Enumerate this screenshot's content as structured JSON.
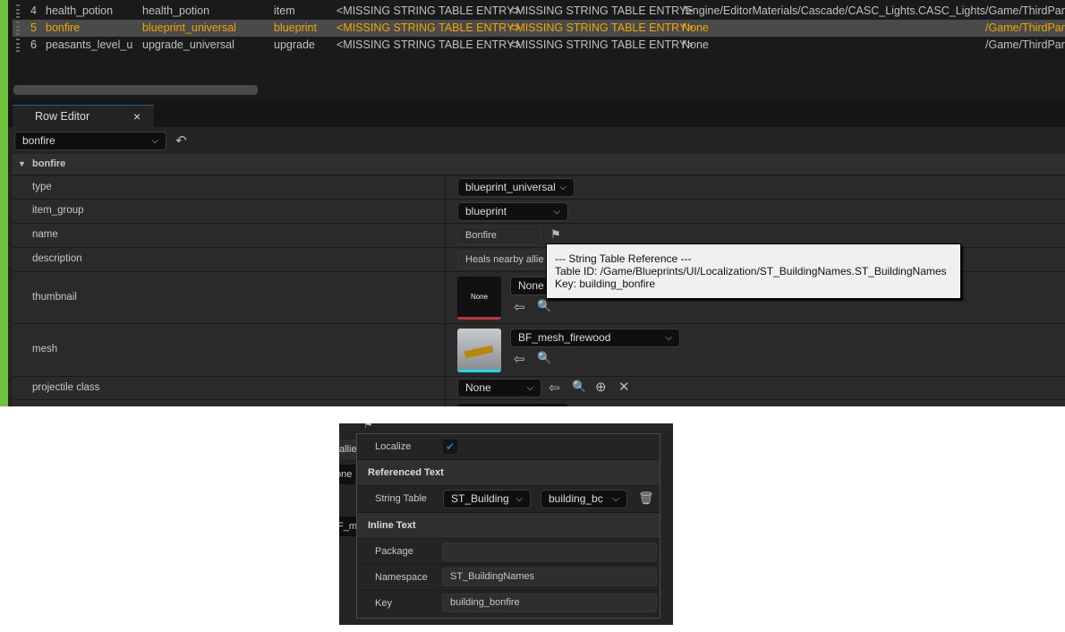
{
  "table": {
    "rows": [
      {
        "num": "4",
        "name": "health_potion",
        "c2": "health_potion",
        "c3": "item",
        "c4": "<MISSING STRING TABLE ENTRY>",
        "c5": "<MISSING STRING TABLE ENTRY>",
        "c6": "/Engine/EditorMaterials/Cascade/CASC_Lights.CASC_Lights",
        "c7": "/Game/ThirdPar"
      },
      {
        "num": "5",
        "name": "bonfire",
        "c2": "blueprint_universal",
        "c3": "blueprint",
        "c4": "<MISSING STRING TABLE ENTRY>",
        "c5": "<MISSING STRING TABLE ENTRY>",
        "c6": "None",
        "c7": "/Game/ThirdPar"
      },
      {
        "num": "6",
        "name": "peasants_level_u",
        "c2": "upgrade_universal",
        "c3": "upgrade",
        "c4": "<MISSING STRING TABLE ENTRY>",
        "c5": "<MISSING STRING TABLE ENTRY>",
        "c6": "None",
        "c7": "/Game/ThirdPar"
      }
    ]
  },
  "row_editor": {
    "tab_label": "Row Editor",
    "close": "×",
    "row_select": "bonfire",
    "section": "bonfire",
    "props": {
      "type": {
        "label": "type",
        "value": "blueprint_universal"
      },
      "item_group": {
        "label": "item_group",
        "value": "blueprint"
      },
      "name": {
        "label": "name",
        "value": "Bonfire"
      },
      "description": {
        "label": "description",
        "value": "Heals nearby allie"
      },
      "thumbnail": {
        "label": "thumbnail",
        "thumb": "None",
        "value": "None"
      },
      "mesh": {
        "label": "mesh",
        "value": "BF_mesh_firewood"
      },
      "projectile_class": {
        "label": "projectile class",
        "value": "None"
      }
    }
  },
  "tooltip": {
    "line1": "--- String Table Reference ---",
    "line2": "Table ID: /Game/Blueprints/UI/Localization/ST_BuildingNames.ST_BuildingNames",
    "line3": "Key: building_bonfire"
  },
  "popup": {
    "localize_label": "Localize",
    "localize_checked": true,
    "referenced_header": "Referenced Text",
    "string_table_label": "String Table",
    "string_table_value": "ST_Building",
    "key_value": "building_bc",
    "inline_header": "Inline Text",
    "package_label": "Package",
    "package_value": "",
    "namespace_label": "Namespace",
    "namespace_value": "ST_BuildingNames",
    "key_label": "Key",
    "key_field_value": "building_bonfire",
    "bg_fragments": {
      "a": "allie",
      "b": "one",
      "c": "F_me"
    }
  },
  "colors": {
    "accent": "#f0a500",
    "green": "#6cc33c",
    "checkbox": "#2f78c8"
  }
}
